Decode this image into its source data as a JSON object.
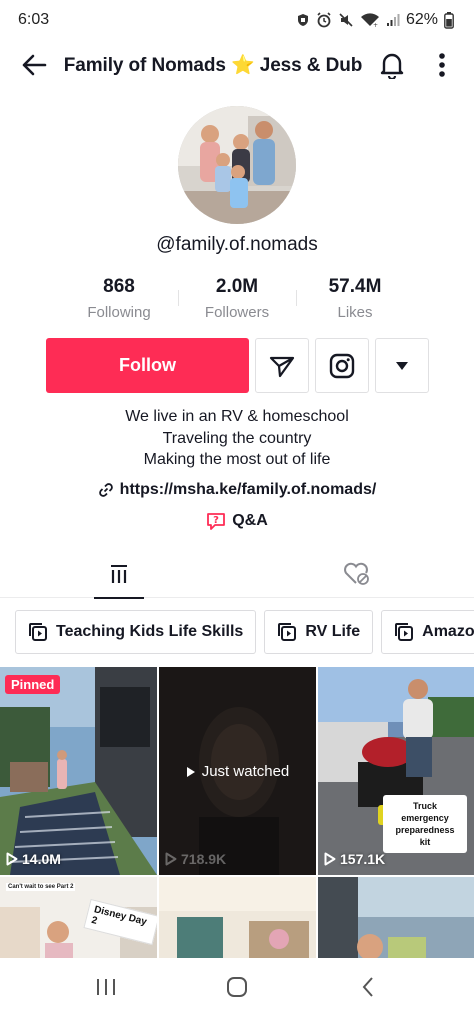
{
  "status_bar": {
    "time": "6:03",
    "battery": "62%"
  },
  "header": {
    "title": "Family of Nomads ⭐ Jess & Dub"
  },
  "profile": {
    "username": "@family.of.nomads",
    "stats": [
      {
        "value": "868",
        "label": "Following"
      },
      {
        "value": "2.0M",
        "label": "Followers"
      },
      {
        "value": "57.4M",
        "label": "Likes"
      }
    ],
    "follow_label": "Follow",
    "bio": [
      "We live in an RV & homeschool",
      "Traveling the country",
      "Making the most out of life"
    ],
    "link": "https://msha.ke/family.of.nomads/",
    "qa_label": "Q&A"
  },
  "playlists": [
    {
      "label": "Teaching Kids Life Skills"
    },
    {
      "label": "RV Life"
    },
    {
      "label": "Amazon Fi"
    }
  ],
  "videos": [
    {
      "views": "14.0M",
      "badge": "Pinned"
    },
    {
      "views": "718.9K",
      "overlay": "Just watched"
    },
    {
      "views": "157.1K",
      "caption": "Truck emergency preparedness kit"
    },
    {
      "caption_top": "Can't wait to see Part 2",
      "sticker": "Disney Day 2"
    },
    {},
    {}
  ],
  "colors": {
    "accent": "#fe2c55",
    "text": "#161823",
    "muted": "#8a8b91"
  }
}
